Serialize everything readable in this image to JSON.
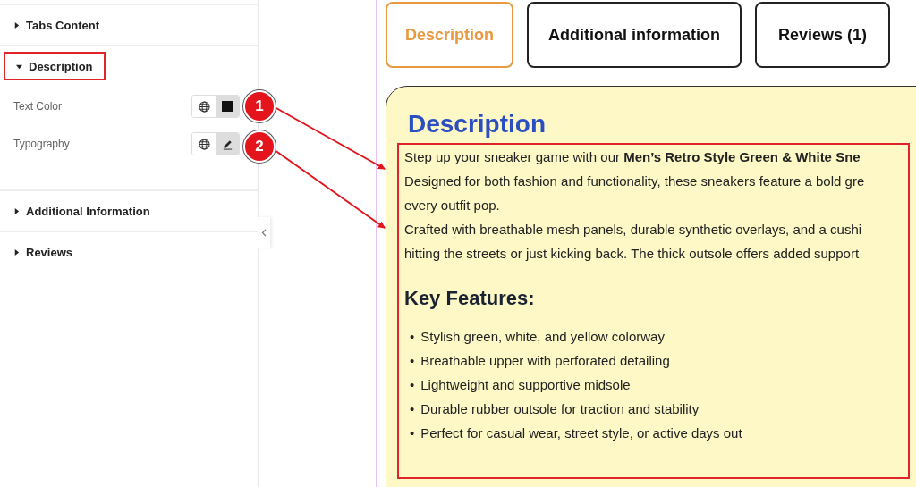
{
  "panel": {
    "sections": [
      {
        "title": "Tabs Content",
        "expanded": false,
        "outlined": false
      },
      {
        "title": "Description",
        "expanded": true,
        "outlined": true,
        "controls": [
          {
            "label": "Text Color",
            "kind": "color",
            "color": "#111111"
          },
          {
            "label": "Typography",
            "kind": "typography"
          }
        ]
      },
      {
        "title": "Additional Information",
        "expanded": false,
        "outlined": false
      },
      {
        "title": "Reviews",
        "expanded": false,
        "outlined": false
      }
    ]
  },
  "annotations": [
    {
      "number": "1"
    },
    {
      "number": "2"
    }
  ],
  "preview": {
    "tabs": [
      {
        "label": "Description",
        "selected": true
      },
      {
        "label": "Additional information",
        "selected": false
      },
      {
        "label": "Reviews (1)",
        "selected": false
      }
    ],
    "heading": "Description",
    "outlined": true,
    "paragraph_lines": [
      "Step up your sneaker game with our **Men’s Retro Style Green & White Sne**",
      "Designed for both fashion and functionality, these sneakers feature a bold gre",
      "every outfit pop.",
      "Crafted with breathable mesh panels, durable synthetic overlays, and a cushi",
      "hitting the streets or just kicking back. The thick outsole offers added support"
    ],
    "features_heading": "Key Features:",
    "features": [
      {
        "bullet": "•",
        "text": "Stylish green, white, and yellow colorway"
      },
      {
        "bullet": "•",
        "text": "Breathable upper with perforated detailing"
      },
      {
        "bullet": "•",
        "text": "Lightweight and supportive midsole"
      },
      {
        "bullet": "•",
        "text": "Durable rubber outsole for traction and stability"
      },
      {
        "bullet": "•",
        "text": "Perfect for casual wear, street style, or active days out"
      }
    ]
  }
}
